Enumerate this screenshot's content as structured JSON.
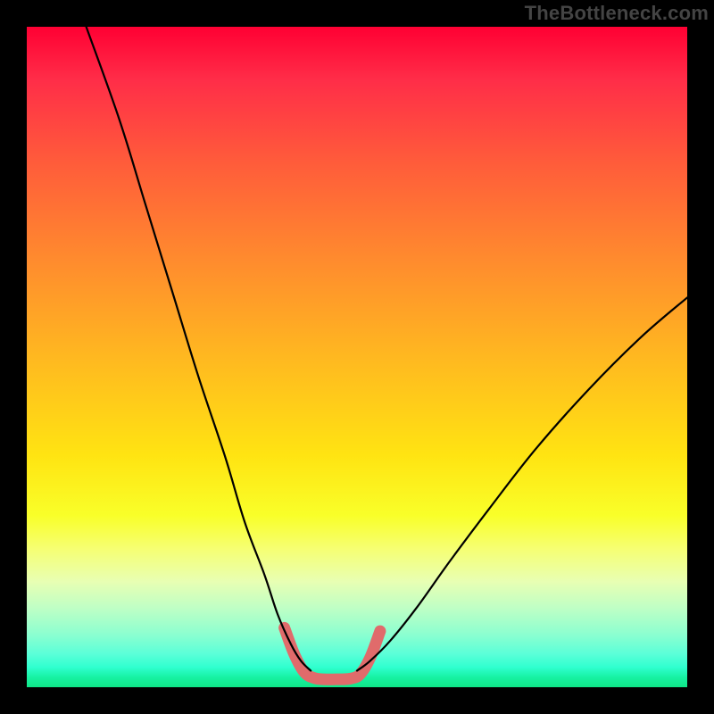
{
  "watermark": "TheBottleneck.com",
  "chart_data": {
    "type": "line",
    "title": "",
    "xlabel": "",
    "ylabel": "",
    "xlim": [
      0,
      100
    ],
    "ylim": [
      0,
      100
    ],
    "grid": false,
    "legend": false,
    "series": [
      {
        "name": "left-curve",
        "color": "#000000",
        "x": [
          9,
          14,
          18,
          22,
          26,
          30,
          33,
          36,
          38,
          40,
          41.5,
          43
        ],
        "y": [
          100,
          86,
          73,
          60,
          47,
          35,
          25,
          17,
          11,
          6.5,
          4,
          2.5
        ]
      },
      {
        "name": "right-curve",
        "color": "#000000",
        "x": [
          50,
          52,
          55,
          59,
          64,
          70,
          77,
          85,
          93,
          100
        ],
        "y": [
          2.5,
          4,
          7,
          12,
          19,
          27,
          36,
          45,
          53,
          59
        ]
      },
      {
        "name": "valley-highlight",
        "color": "#e06b6b",
        "x": [
          39,
          40.5,
          42,
          43.5,
          45,
          47,
          49,
          50.5,
          52,
          53.5
        ],
        "y": [
          9,
          5,
          2.3,
          1.4,
          1.2,
          1.2,
          1.3,
          2.0,
          4.5,
          8.5
        ]
      }
    ],
    "gradient_stops": [
      {
        "pos": 0,
        "color": "#ff0033"
      },
      {
        "pos": 8,
        "color": "#ff2d48"
      },
      {
        "pos": 20,
        "color": "#ff5a3b"
      },
      {
        "pos": 35,
        "color": "#ff8a2e"
      },
      {
        "pos": 50,
        "color": "#ffb820"
      },
      {
        "pos": 65,
        "color": "#ffe412"
      },
      {
        "pos": 74,
        "color": "#f9ff29"
      },
      {
        "pos": 79,
        "color": "#f6ff72"
      },
      {
        "pos": 84,
        "color": "#e8ffb3"
      },
      {
        "pos": 88,
        "color": "#bfffc5"
      },
      {
        "pos": 92,
        "color": "#8cffd0"
      },
      {
        "pos": 95,
        "color": "#5affd8"
      },
      {
        "pos": 97,
        "color": "#2fffcf"
      },
      {
        "pos": 98.5,
        "color": "#17f2a2"
      },
      {
        "pos": 100,
        "color": "#0fe787"
      }
    ]
  }
}
